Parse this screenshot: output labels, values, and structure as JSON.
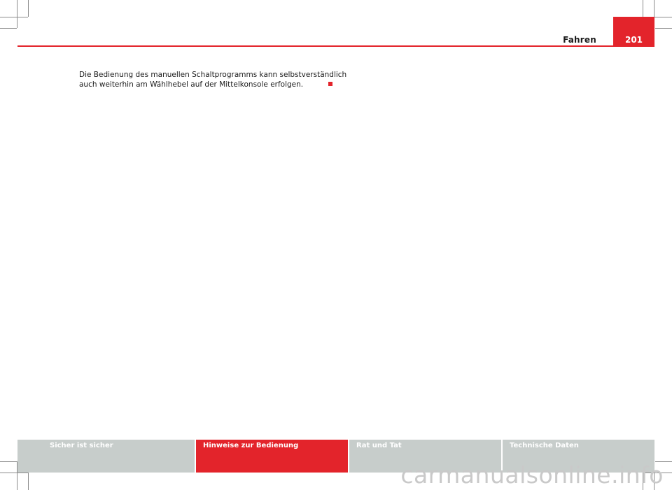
{
  "header": {
    "chapter_title": "Fahren",
    "page_number": "201"
  },
  "body": {
    "lines": [
      "Die Bedienung des manuellen Schaltprogramms kann selbstverständlich",
      "auch weiterhin am Wählhebel auf der Mittelkonsole erfolgen."
    ]
  },
  "footer": {
    "tabs": [
      {
        "label": "Sicher ist sicher"
      },
      {
        "label": "Hinweise zur Bedienung"
      },
      {
        "label": "Rat und Tat"
      },
      {
        "label": "Technische Daten"
      }
    ]
  },
  "watermark": "carmanualsonline.info",
  "colors": {
    "accent": "#e3242b",
    "footer_inactive": "#c7cdcb"
  }
}
